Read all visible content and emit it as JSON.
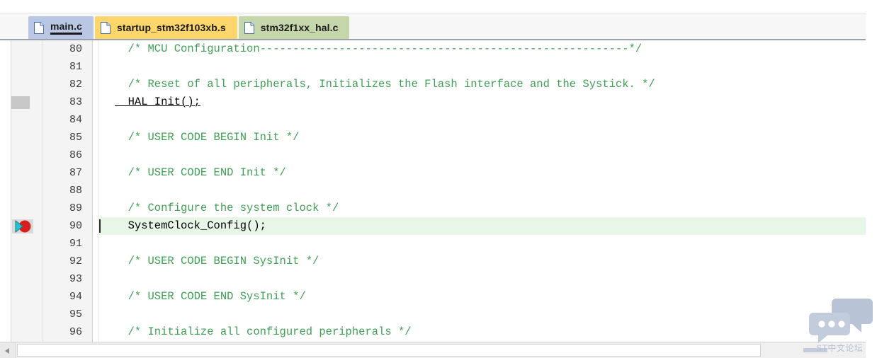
{
  "editor": {
    "tabs": [
      {
        "label": "main.c",
        "state": "active",
        "icon": "file-icon",
        "color": "#b9c6e4"
      },
      {
        "label": "startup_stm32f103xb.s",
        "state": "modified",
        "icon": "file-icon",
        "color": "#fcd66b"
      },
      {
        "label": "stm32f1xx_hal.c",
        "state": "inactive",
        "icon": "file-icon",
        "color": "#c5d6ab"
      }
    ],
    "lines": [
      {
        "number": "80",
        "text": "  /* MCU Configuration--------------------------------------------------------*/",
        "kind": "comment",
        "marker": "",
        "highlight": false
      },
      {
        "number": "81",
        "text": "",
        "kind": "plain",
        "marker": "",
        "highlight": false
      },
      {
        "number": "82",
        "text": "  /* Reset of all peripherals, Initializes the Flash interface and the Systick. */",
        "kind": "comment",
        "marker": "",
        "highlight": false
      },
      {
        "number": "83",
        "text": "  HAL_Init();",
        "kind": "code-underlined-call",
        "marker": "occurrence-box",
        "highlight": false
      },
      {
        "number": "84",
        "text": "",
        "kind": "plain",
        "marker": "",
        "highlight": false
      },
      {
        "number": "85",
        "text": "  /* USER CODE BEGIN Init */",
        "kind": "comment",
        "marker": "",
        "highlight": false
      },
      {
        "number": "86",
        "text": "",
        "kind": "plain",
        "marker": "",
        "highlight": false
      },
      {
        "number": "87",
        "text": "  /* USER CODE END Init */",
        "kind": "comment",
        "marker": "",
        "highlight": false
      },
      {
        "number": "88",
        "text": "",
        "kind": "plain",
        "marker": "",
        "highlight": false
      },
      {
        "number": "89",
        "text": "  /* Configure the system clock */",
        "kind": "comment",
        "marker": "",
        "highlight": false
      },
      {
        "number": "90",
        "text": "  SystemClock_Config();",
        "kind": "code",
        "marker": "breakpoint-instruction-pointer",
        "highlight": true
      },
      {
        "number": "91",
        "text": "",
        "kind": "plain",
        "marker": "",
        "highlight": false
      },
      {
        "number": "92",
        "text": "  /* USER CODE BEGIN SysInit */",
        "kind": "comment",
        "marker": "",
        "highlight": false
      },
      {
        "number": "93",
        "text": "",
        "kind": "plain",
        "marker": "",
        "highlight": false
      },
      {
        "number": "94",
        "text": "  /* USER CODE END SysInit */",
        "kind": "comment",
        "marker": "",
        "highlight": false
      },
      {
        "number": "95",
        "text": "",
        "kind": "plain",
        "marker": "",
        "highlight": false
      },
      {
        "number": "96",
        "text": "  /* Initialize all configured peripherals */",
        "kind": "comment",
        "marker": "",
        "highlight": false
      }
    ],
    "colors": {
      "comment": "#3f9f55",
      "code": "#000000",
      "current_line_highlight": "#e8f6e8",
      "breakpoint": "#d81f1f",
      "instruction_pointer": "#24c4cf",
      "active_tab": "#b9c6e4",
      "modified_tab": "#fcd66b",
      "inactive_tab": "#c5d6ab"
    }
  },
  "scrollbar": {
    "orientation": "horizontal",
    "left_arrow": "◀"
  },
  "watermark": {
    "text": "ST中文论坛",
    "icon": "speech-bubbles-icon"
  }
}
